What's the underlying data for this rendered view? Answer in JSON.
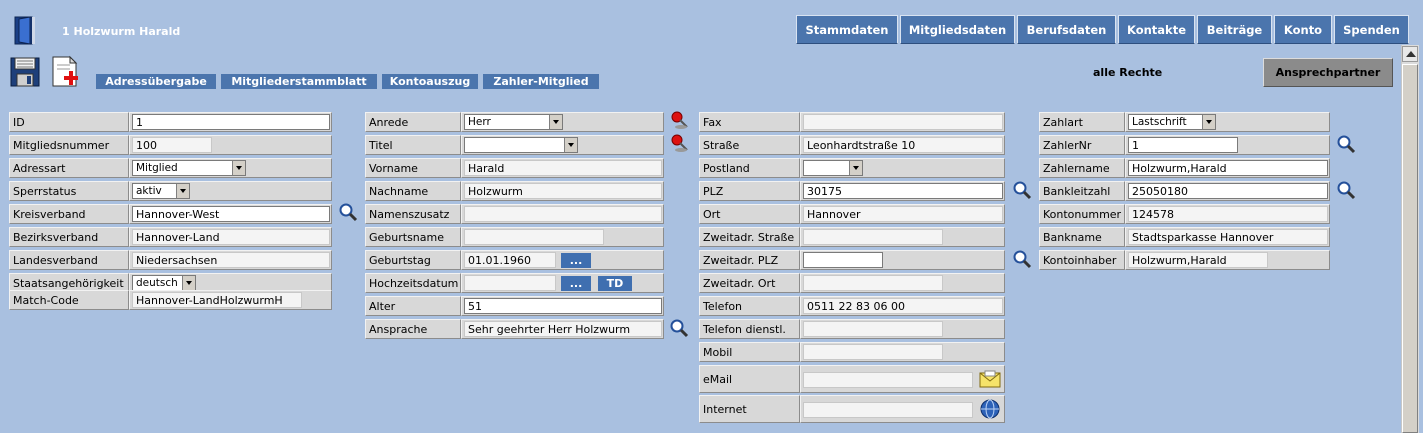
{
  "header": {
    "title": "1 Holzwurm Harald",
    "door_icon": "door-icon"
  },
  "tabs": [
    "Stammdaten",
    "Mitgliedsdaten",
    "Berufsdaten",
    "Kontakte",
    "Beiträge",
    "Konto",
    "Spenden"
  ],
  "toolbar": {
    "icons": [
      "save-icon",
      "new-document-icon"
    ],
    "links": [
      "Adressübergabe",
      "Mitgliederstammblatt",
      "Kontoauszug",
      "Zahler-Mitglied"
    ],
    "rights": "alle Rechte",
    "contact_button": "Ansprechpartner"
  },
  "col1": [
    {
      "label": "ID",
      "value": "1"
    },
    {
      "label": "Mitgliedsnummer",
      "value": "100"
    },
    {
      "label": "Adressart",
      "value": "Mitglied"
    },
    {
      "label": "Sperrstatus",
      "value": "aktiv"
    },
    {
      "label": "Kreisverband",
      "value": "Hannover-West"
    },
    {
      "label": "Bezirksverband",
      "value": "Hannover-Land"
    },
    {
      "label": "Landesverband",
      "value": "Niedersachsen"
    },
    {
      "label": "Staatsangehörigkeit",
      "value": "deutsch"
    },
    {
      "label": "Match-Code",
      "value": "Hannover-LandHolzwurmH"
    }
  ],
  "col2": [
    {
      "label": "Anrede",
      "value": "Herr"
    },
    {
      "label": "Titel",
      "value": ""
    },
    {
      "label": "Vorname",
      "value": "Harald"
    },
    {
      "label": "Nachname",
      "value": "Holzwurm"
    },
    {
      "label": "Namenszusatz",
      "value": ""
    },
    {
      "label": "Geburtsname",
      "value": ""
    },
    {
      "label": "Geburtstag",
      "value": "01.01.1960"
    },
    {
      "label": "Hochzeitsdatum",
      "value": ""
    },
    {
      "label": "Alter",
      "value": "51"
    },
    {
      "label": "Ansprache",
      "value": "Sehr geehrter Herr Holzwurm"
    }
  ],
  "col2_buttons": {
    "date_picker": "...",
    "today": "TD"
  },
  "col3": [
    {
      "label": "Fax",
      "value": ""
    },
    {
      "label": "Straße",
      "value": "Leonhardtstraße 10"
    },
    {
      "label": "Postland",
      "value": ""
    },
    {
      "label": "PLZ",
      "value": "30175"
    },
    {
      "label": "Ort",
      "value": "Hannover"
    },
    {
      "label": "Zweitadr. Straße",
      "value": ""
    },
    {
      "label": "Zweitadr. PLZ",
      "value": ""
    },
    {
      "label": "Zweitadr. Ort",
      "value": ""
    },
    {
      "label": "Telefon",
      "value": "0511 22 83 06 00"
    },
    {
      "label": "Telefon dienstl.",
      "value": ""
    },
    {
      "label": "Mobil",
      "value": ""
    },
    {
      "label": "eMail",
      "value": ""
    },
    {
      "label": "Internet",
      "value": ""
    }
  ],
  "col4": [
    {
      "label": "Zahlart",
      "value": "Lastschrift"
    },
    {
      "label": "ZahlerNr",
      "value": "1"
    },
    {
      "label": "Zahlername",
      "value": "Holzwurm,Harald"
    },
    {
      "label": "Bankleitzahl",
      "value": "25050180"
    },
    {
      "label": "Kontonummer",
      "value": "124578"
    },
    {
      "label": "Bankname",
      "value": "Stadtsparkasse Hannover"
    },
    {
      "label": "Kontoinhaber",
      "value": "Holzwurm,Harald"
    }
  ],
  "icons": {
    "search": "search-magnifier-icon",
    "pin": "pushpin-icon",
    "email": "email-envelope-icon",
    "internet": "globe-icon"
  }
}
